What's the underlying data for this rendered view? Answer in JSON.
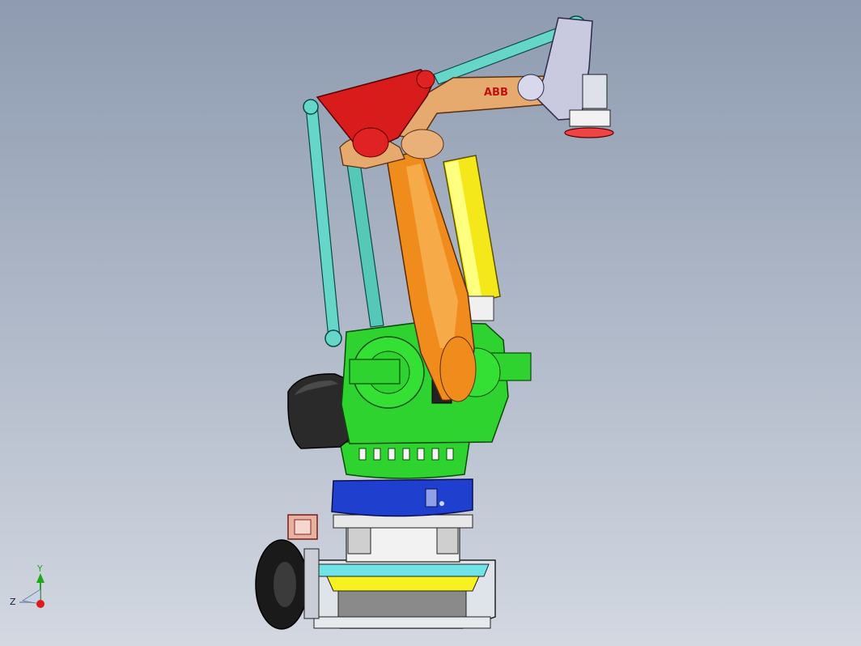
{
  "viewport": {
    "background_top": "#8e9bb0",
    "background_bottom": "#d3d8e1"
  },
  "model": {
    "logo_text": "ABB",
    "colors": {
      "wrist_plate": "#c9c9e0",
      "upper_arm": "#e6a96e",
      "tie_rod": "#66d6c8",
      "red_link": "#d81b1b",
      "lower_arm": "#f08c1c",
      "cylinder": "#f5e81a",
      "base_green": "#2fd32f",
      "motor_black": "#2a2a2a",
      "turntable_blue": "#1f3fcf",
      "cart_yellow": "#f7f21f",
      "wheel_black": "#1a1a1a"
    }
  },
  "triad": {
    "y_label": "Y",
    "z_label": "Z",
    "y_color": "#1fa81f",
    "z_color": "#e01a1a"
  }
}
